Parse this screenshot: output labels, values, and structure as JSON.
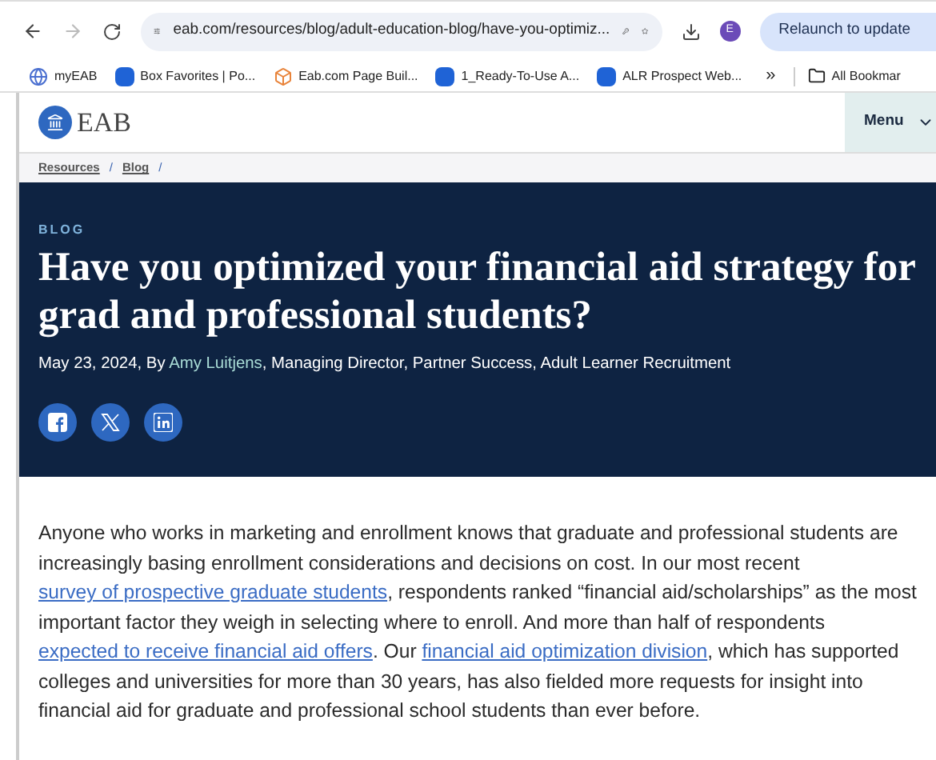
{
  "browser": {
    "url": "eab.com/resources/blog/adult-education-blog/have-you-optimiz...",
    "profile_initial": "E",
    "relaunch_button": "Relaunch to update",
    "bookmarks": [
      {
        "label": "myEAB",
        "kind": "globe"
      },
      {
        "label": "Box Favorites | Po...",
        "kind": "box"
      },
      {
        "label": "Eab.com Page Buil...",
        "kind": "cube"
      },
      {
        "label": "1_Ready-To-Use A...",
        "kind": "box"
      },
      {
        "label": "ALR Prospect Web...",
        "kind": "box"
      }
    ],
    "overflow": "»",
    "all_bookmarks": "All Bookmar"
  },
  "site": {
    "logo": "EAB",
    "menu": "Menu"
  },
  "breadcrumbs": [
    {
      "label": "Resources",
      "separator": "/"
    },
    {
      "label": "Blog",
      "separator": "/"
    }
  ],
  "hero": {
    "eyebrow": "BLOG",
    "title": "Have you optimized your financial aid strategy for grad and professional students?",
    "byline_date": "May 23, 2024, By ",
    "author": "Amy Luitjens",
    "byline_role": ", Managing Director, Partner Success, Adult Learner Recruitment",
    "share": [
      {
        "kind": "facebook"
      },
      {
        "kind": "x"
      },
      {
        "kind": "linkedin"
      }
    ]
  },
  "paragraph": [
    {
      "kind": "text",
      "text": "Anyone who works in marketing and enrollment knows that graduate and professional students are increasingly basing enrollment considerations and decisions on cost. In our most recent "
    },
    {
      "kind": "link",
      "text": "survey of prospective graduate students"
    },
    {
      "kind": "text",
      "text": ", respondents ranked “financial aid/scholarships” as the most important factor they weigh in selecting where to enroll. And more than half of respondents "
    },
    {
      "kind": "link",
      "text": "expected to receive financial aid offers"
    },
    {
      "kind": "text",
      "text": ". Our "
    },
    {
      "kind": "link",
      "text": "financial aid optimization division"
    },
    {
      "kind": "text",
      "text": ", which has supported colleges and universities for more than 30 years, has also fielded more requests for insight into financial aid for graduate and professional school students than ever before."
    }
  ]
}
